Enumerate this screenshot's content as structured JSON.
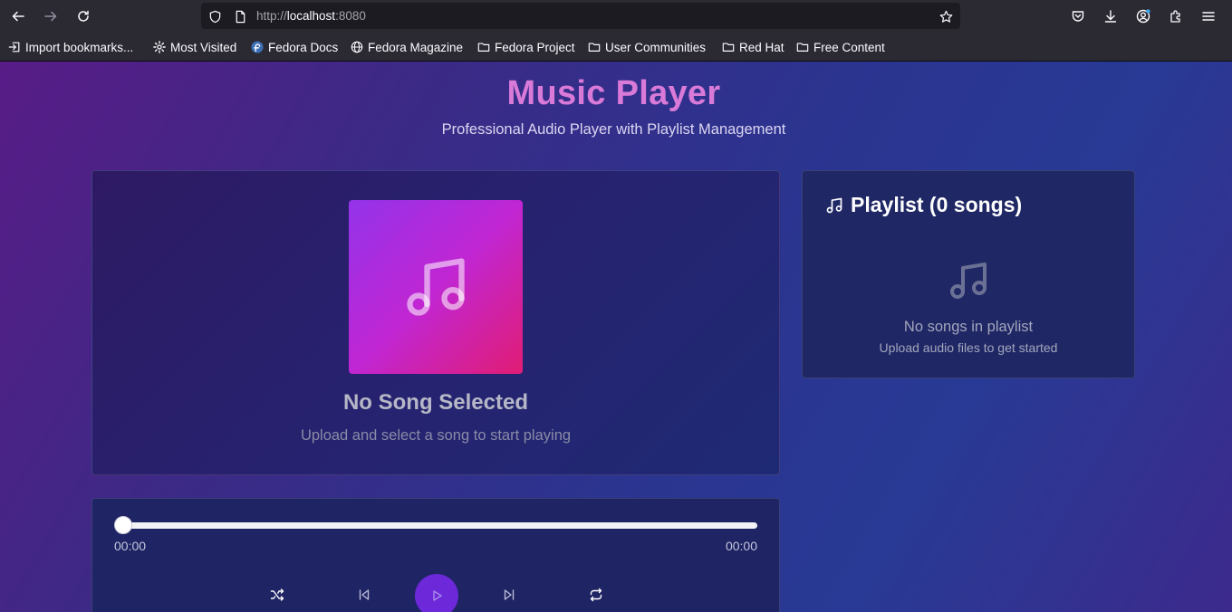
{
  "browser": {
    "url_protocol": "http://",
    "url_host": "localhost",
    "url_port": ":8080",
    "bookmarks": [
      {
        "label": "Import bookmarks...",
        "icon": "import-icon"
      },
      {
        "label": "Most Visited",
        "icon": "gear-icon"
      },
      {
        "label": "Fedora Docs",
        "icon": "fedora-icon"
      },
      {
        "label": "Fedora Magazine",
        "icon": "globe-icon"
      },
      {
        "label": "Fedora Project",
        "icon": "folder-icon"
      },
      {
        "label": "User Communities",
        "icon": "folder-icon"
      },
      {
        "label": "Red Hat",
        "icon": "folder-icon"
      },
      {
        "label": "Free Content",
        "icon": "folder-icon"
      }
    ]
  },
  "header": {
    "title": "Music Player",
    "subtitle": "Professional Audio Player with Playlist Management"
  },
  "now_playing": {
    "title": "No Song Selected",
    "subtitle": "Upload and select a song to start playing"
  },
  "playlist": {
    "title": "Playlist (0 songs)",
    "empty_title": "No songs in playlist",
    "empty_subtitle": "Upload audio files to get started"
  },
  "player": {
    "current_time": "00:00",
    "duration": "00:00",
    "progress": 0
  },
  "colors": {
    "accent": "#6d28d9",
    "title": "#d97ad8",
    "art_gradient_start": "#9333ea",
    "art_gradient_end": "#e11d74"
  }
}
